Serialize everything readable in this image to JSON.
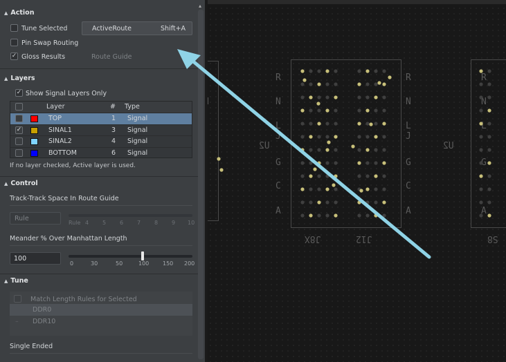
{
  "action": {
    "title": "Action",
    "tune_selected": "Tune Selected",
    "active_route": "ActiveRoute",
    "active_route_shortcut": "Shift+A",
    "pin_swap": "Pin Swap Routing",
    "gloss_results": "Gloss Results",
    "route_guide": "Route Guide"
  },
  "layers": {
    "title": "Layers",
    "show_signal_only": "Show Signal Layers Only",
    "columns": {
      "layer": "Layer",
      "num": "#",
      "type": "Type"
    },
    "rows": [
      {
        "name": "TOP",
        "num": "1",
        "type": "Signal",
        "color": "#ff0000",
        "checked": false,
        "selected": true
      },
      {
        "name": "SINAL1",
        "num": "3",
        "type": "Signal",
        "color": "#c8a000",
        "checked": true,
        "selected": false
      },
      {
        "name": "SINAL2",
        "num": "4",
        "type": "Signal",
        "color": "#7fd4ff",
        "checked": false,
        "selected": false
      },
      {
        "name": "BOTTOM",
        "num": "6",
        "type": "Signal",
        "color": "#0000ff",
        "checked": false,
        "selected": false
      }
    ],
    "note": "If no layer checked, Active layer is used."
  },
  "control": {
    "title": "Control",
    "track_label": "Track-Track Space In Route Guide",
    "rule_placeholder": "Rule",
    "rule_ticks": [
      "Rule",
      "4",
      "5",
      "6",
      "7",
      "8",
      "9",
      "10"
    ],
    "meander_label": "Meander % Over Manhattan Length",
    "meander_value": "100",
    "meander_ticks": [
      "0",
      "30",
      "50",
      "100",
      "150",
      "200"
    ],
    "meander_level": 100
  },
  "tune": {
    "title": "Tune",
    "match_length": "Match Length Rules for Selected",
    "items": [
      "DDR0",
      "DDR10"
    ],
    "single_ended": "Single Ended"
  },
  "pcb": {
    "label_left": "J8X",
    "label_mid": "J12",
    "label_u": "U2",
    "label_n": "N",
    "label_right": "S8",
    "side_letters": [
      "R",
      "N",
      "L",
      "J",
      "G",
      "C",
      "A"
    ]
  },
  "colors": {
    "arrow": "#8fd3e6",
    "selected_row": "#5f7fa0",
    "via": "#c8c07a"
  }
}
